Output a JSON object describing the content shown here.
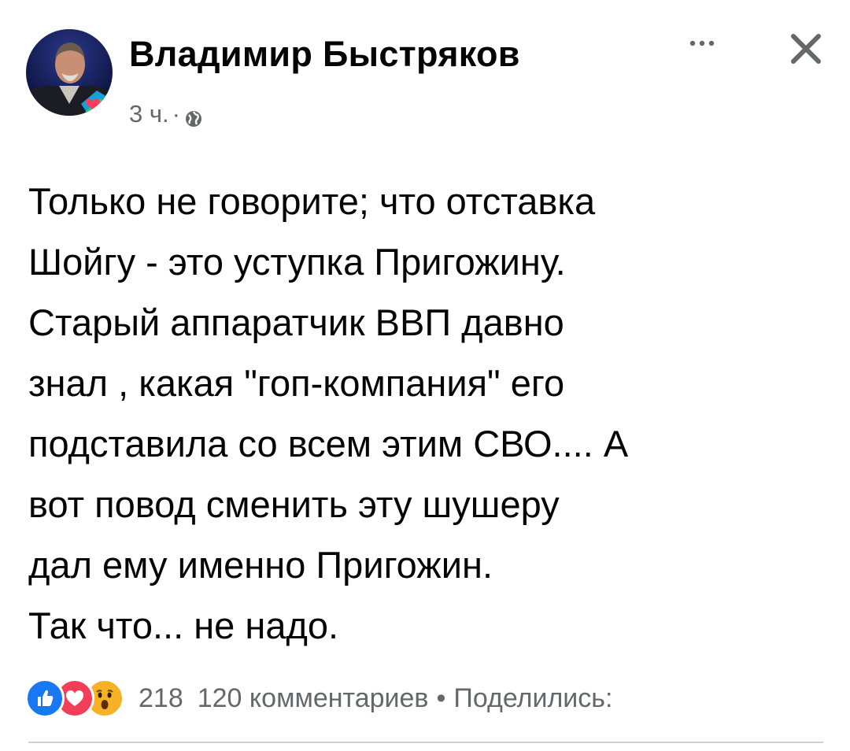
{
  "post": {
    "author": "Владимир Быстряков",
    "time": "3 ч.",
    "separator": "·",
    "privacy_icon": "globe-icon",
    "more_icon": "more-horizontal-icon",
    "close_icon": "close-icon",
    "lines": [
      "Только не говорите; что отставка",
      "Шойгу - это уступка Пригожину.",
      "Старый аппаратчик ВВП давно",
      "знал , какая \"гоп-компания\" его",
      "подставила со всем этим СВО.... А",
      "вот повод сменить эту шушеру",
      "дал ему именно Пригожин.",
      "Так что...  не надо."
    ]
  },
  "footer": {
    "reaction_icons": [
      "like-icon",
      "love-icon",
      "wow-icon"
    ],
    "reactions_count": "218",
    "comments": "120 комментариев",
    "dot": "•",
    "shares": "Поделились:"
  },
  "colors": {
    "text": "#050505",
    "secondary": "#65676b",
    "like_blue": "#1877f2",
    "love_red": "#f33e58",
    "wow_yellow": "#f7b125"
  }
}
